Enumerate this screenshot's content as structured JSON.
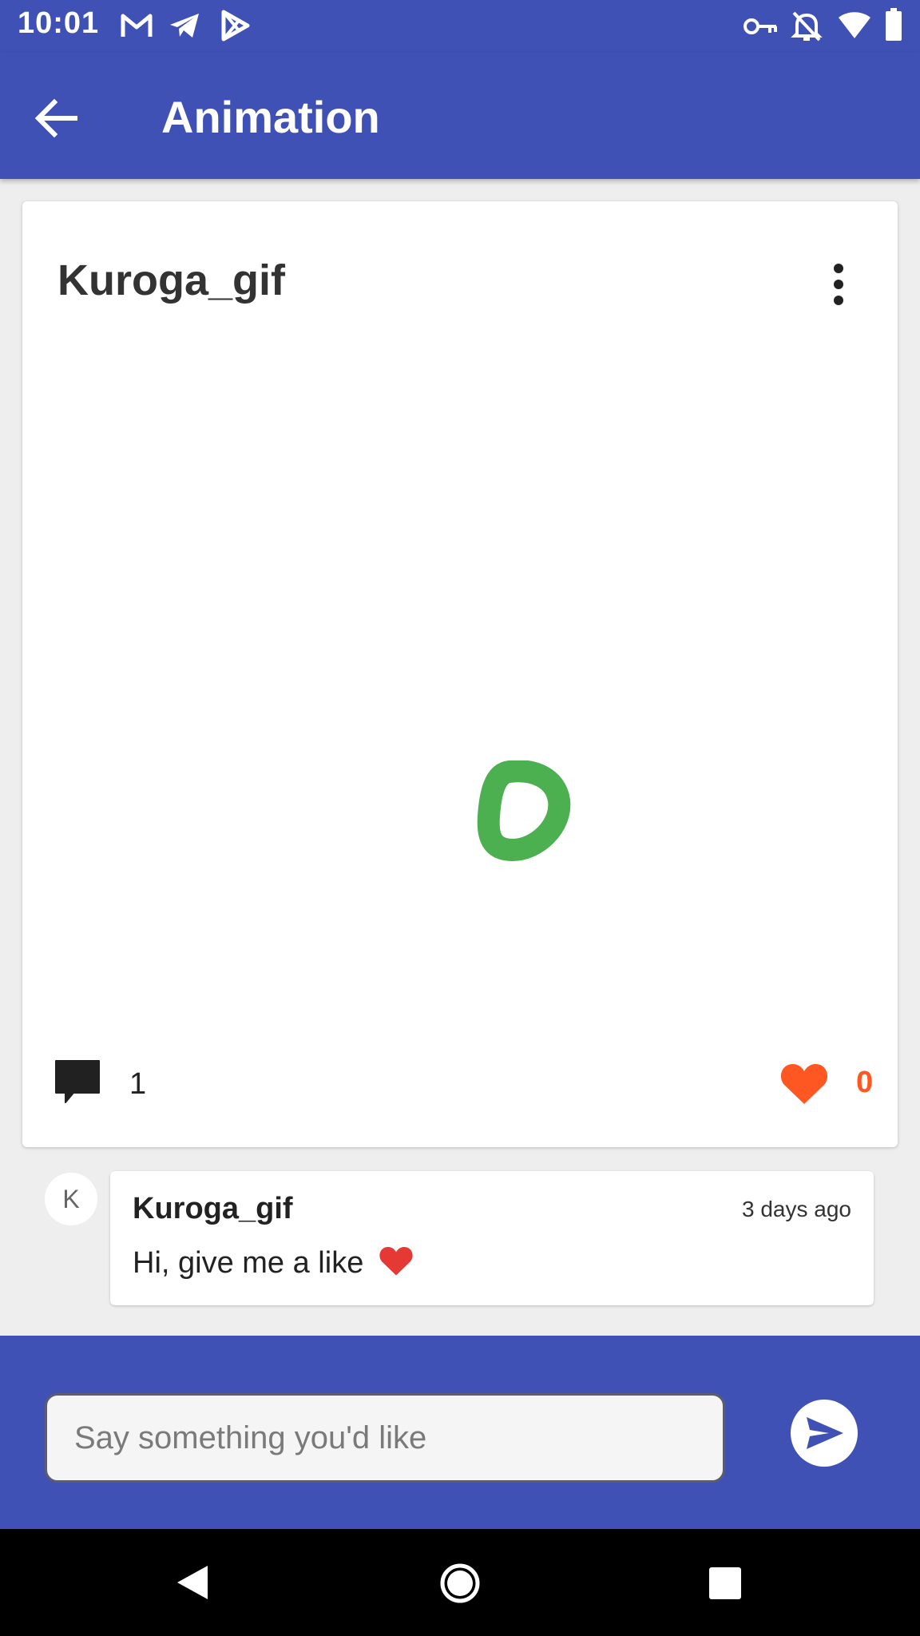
{
  "status_bar": {
    "time": "10:01",
    "left_icons": [
      "gmail-icon",
      "telegram-icon",
      "play-store-icon"
    ],
    "right_icons": [
      "vpn-key-icon",
      "notifications-off-icon",
      "wifi-icon",
      "battery-icon"
    ]
  },
  "app_bar": {
    "back_icon": "arrow-back-icon",
    "title": "Animation"
  },
  "post": {
    "author": "Kuroga_gif",
    "menu_icon": "more-vert-icon",
    "comment_count": "1",
    "like_count": "0"
  },
  "comments": [
    {
      "avatar_letter": "K",
      "author": "Kuroga_gif",
      "time": "3 days ago",
      "text": "Hi, give me a like"
    }
  ],
  "composer": {
    "placeholder": "Say something you'd like",
    "send_icon": "send-icon"
  },
  "colors": {
    "primary": "#3f51b5",
    "accent": "#ff5722",
    "gif_stroke": "#4caf50"
  },
  "navigation": [
    "back-triangle-icon",
    "home-circle-icon",
    "recents-square-icon"
  ]
}
